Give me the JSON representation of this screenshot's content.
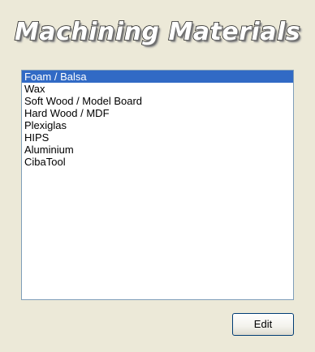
{
  "header": {
    "title": "Machining Materials"
  },
  "materials": {
    "selected_index": 0,
    "items": [
      "Foam / Balsa",
      "Wax",
      "Soft Wood / Model Board",
      "Hard Wood / MDF",
      "Plexiglas",
      "HIPS",
      "Aluminium",
      "CibaTool"
    ]
  },
  "actions": {
    "edit_label": "Edit"
  },
  "colors": {
    "selection": "#316ac5",
    "window_bg": "#ece9d8"
  }
}
